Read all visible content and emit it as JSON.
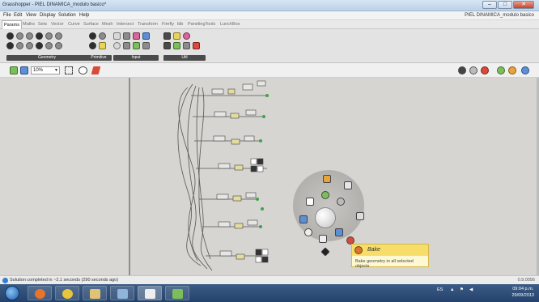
{
  "window": {
    "title": "Grasshopper - PIEL DINAMICA_modulo basico*",
    "doc_title": "PIEL DINAMICA_modulo basico",
    "minimize": "–",
    "maximize": "□",
    "close": "✕"
  },
  "menu": [
    "File",
    "Edit",
    "View",
    "Display",
    "Solution",
    "Help"
  ],
  "tabs": [
    "Params",
    "Maths",
    "Sets",
    "Vector",
    "Curve",
    "Surface",
    "Mesh",
    "Intersect",
    "Transform",
    "Firefly",
    "ldb",
    "PanelingTools",
    "LunchBox"
  ],
  "active_tab": "Params",
  "ribbon_panels": [
    {
      "label": "Geometry"
    },
    {
      "label": "Primitive"
    },
    {
      "label": "Input"
    },
    {
      "label": "Util"
    }
  ],
  "canvas_toolbar": {
    "zoom": "10%"
  },
  "tooltip": {
    "title": "Bake",
    "description": "Bake geometry in all selected objects"
  },
  "status": {
    "message": "Solution completed in ~2.1 seconds (290 seconds ago)",
    "version": "0.9.0056"
  },
  "taskbar": {
    "language": "ES",
    "time": "09:04 p.m.",
    "date": "29/09/2013"
  },
  "colors": {
    "canvas": "#d6d5d1",
    "tooltip_header": "#f7de6a",
    "taskbar": "#24426b"
  }
}
